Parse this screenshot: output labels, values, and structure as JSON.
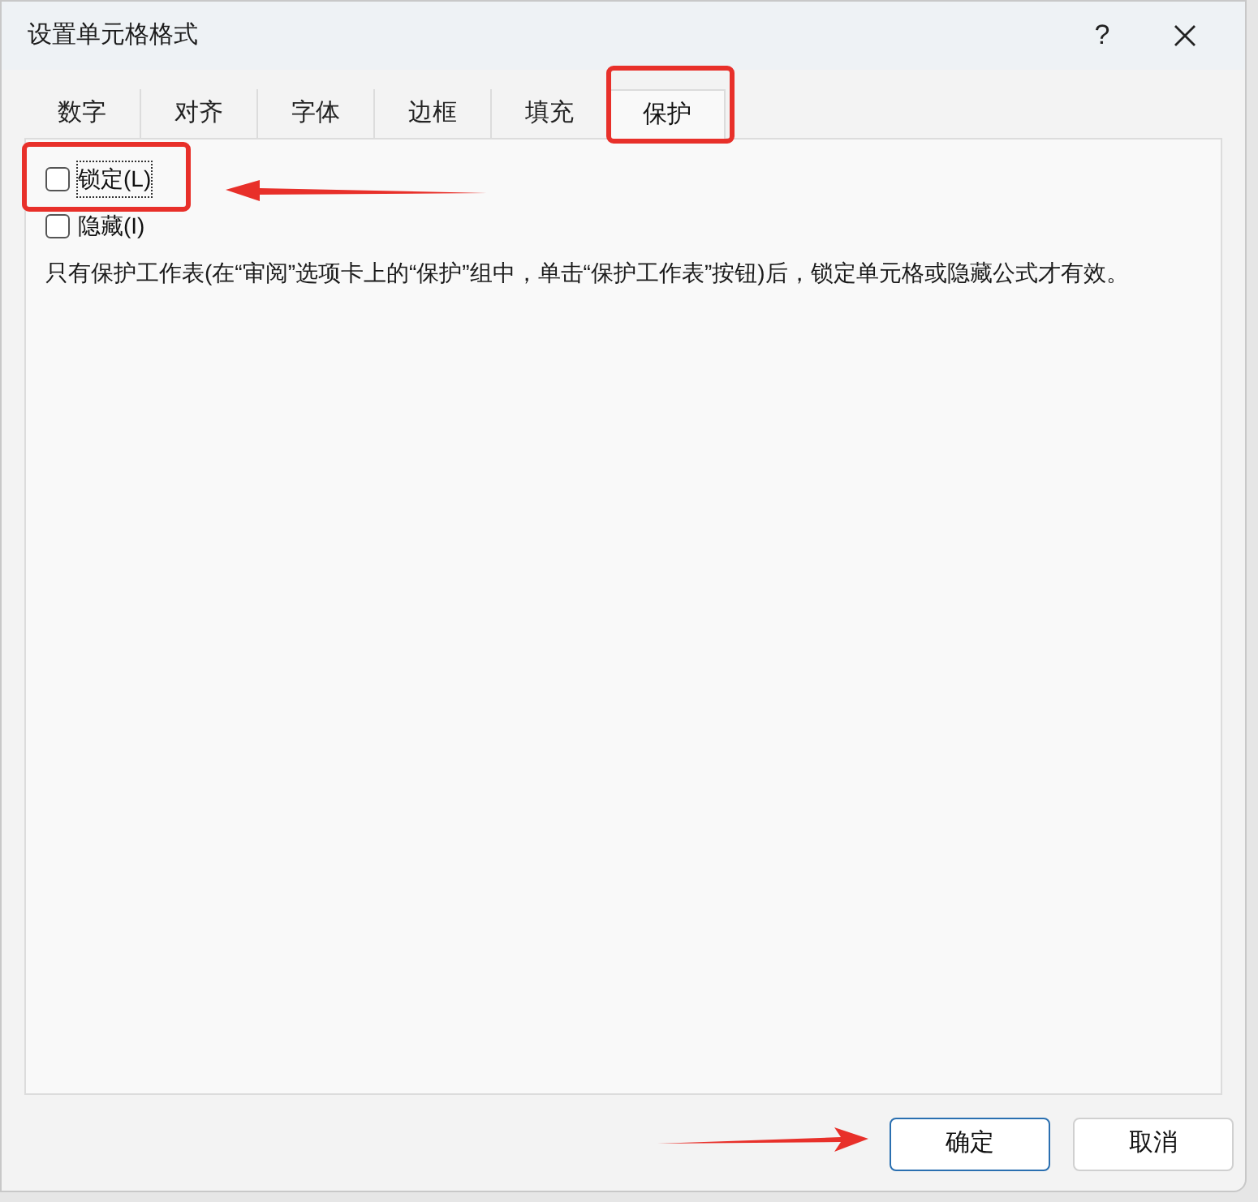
{
  "window": {
    "title": "设置单元格格式",
    "help": "?"
  },
  "tabs": [
    {
      "label": "数字",
      "selected": false
    },
    {
      "label": "对齐",
      "selected": false
    },
    {
      "label": "字体",
      "selected": false
    },
    {
      "label": "边框",
      "selected": false
    },
    {
      "label": "填充",
      "selected": false
    },
    {
      "label": "保护",
      "selected": true
    }
  ],
  "options": [
    {
      "label": "锁定(L)",
      "checked": false,
      "focused": true
    },
    {
      "label": "隐藏(I)",
      "checked": false,
      "focused": false
    }
  ],
  "note": "只有保护工作表(在“审阅”选项卡上的“保护”组中，单击“保护工作表”按钮)后，锁定单元格或隐藏公式才有效。",
  "buttons": [
    {
      "label": "确定",
      "default": true
    },
    {
      "label": "取消",
      "default": false
    }
  ]
}
